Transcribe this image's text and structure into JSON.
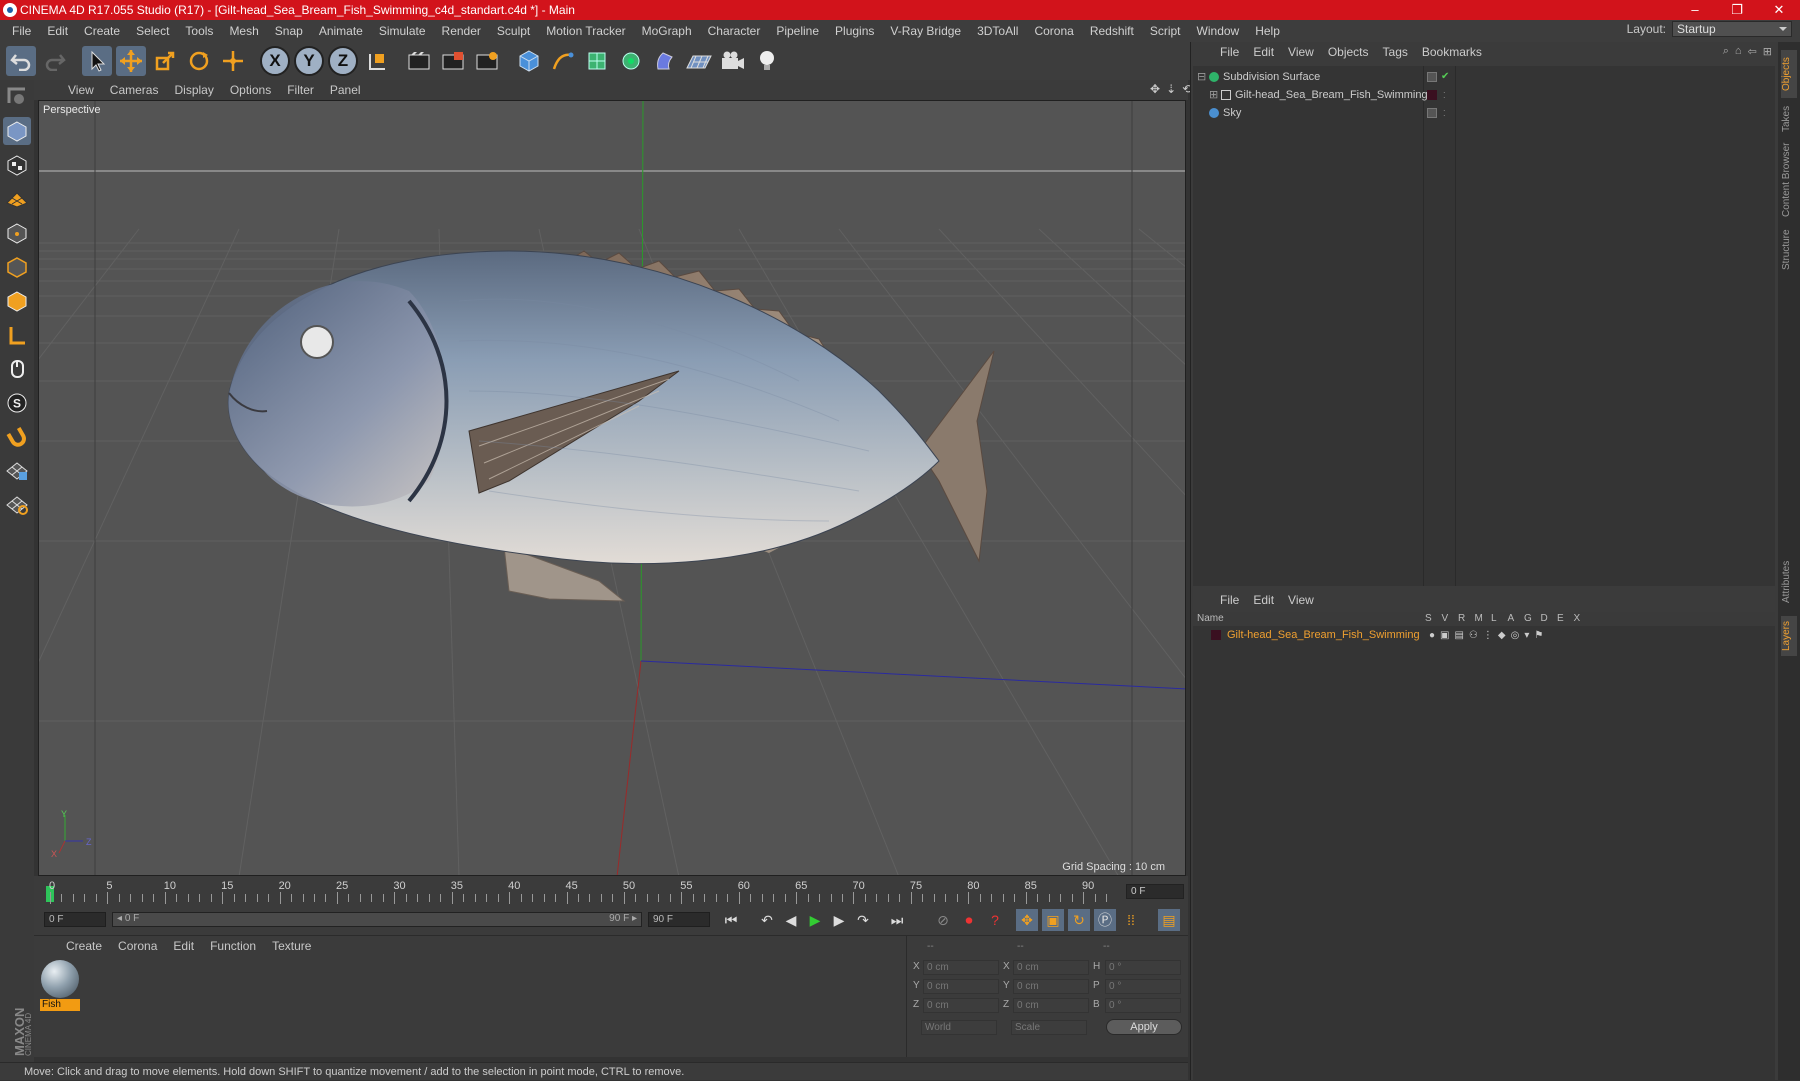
{
  "window": {
    "title": "CINEMA 4D R17.055 Studio (R17) - [Gilt-head_Sea_Bream_Fish_Swimming_c4d_standart.c4d *] - Main",
    "controls": [
      "–",
      "❐",
      "✕"
    ]
  },
  "menu": [
    "File",
    "Edit",
    "Create",
    "Select",
    "Tools",
    "Mesh",
    "Snap",
    "Animate",
    "Simulate",
    "Render",
    "Sculpt",
    "Motion Tracker",
    "MoGraph",
    "Character",
    "Pipeline",
    "Plugins",
    "V-Ray Bridge",
    "3DToAll",
    "Corona",
    "Redshift",
    "Script",
    "Window",
    "Help"
  ],
  "layout": {
    "label": "Layout:",
    "value": "Startup"
  },
  "toolbar": {
    "icons": [
      "undo-icon",
      "redo-icon",
      "select-arrow-icon",
      "move-icon",
      "scale-icon",
      "rotate-icon",
      "transform-icon",
      "x-axis-icon",
      "y-axis-icon",
      "z-axis-icon",
      "world-coord-icon",
      "render-view-icon",
      "render-region-icon",
      "render-settings-icon",
      "cube-icon",
      "pen-icon",
      "subdivision-icon",
      "cloner-icon",
      "deformer-icon",
      "floor-icon",
      "camera-icon",
      "light-icon"
    ],
    "axis_labels": [
      "X",
      "Y",
      "Z"
    ]
  },
  "left_tools": [
    "model-mode-icon",
    "texture-mode-icon",
    "workplane-icon",
    "points-mode-icon",
    "edges-mode-icon",
    "polygons-mode-icon",
    "axis-mode-icon",
    "tweak-icon",
    "solo-icon",
    "magnet-icon",
    "snap-grid-icon",
    "snap-lock-icon"
  ],
  "viewport": {
    "menu": [
      "View",
      "Cameras",
      "Display",
      "Options",
      "Filter",
      "Panel"
    ],
    "label": "Perspective",
    "grid_spacing": "Grid Spacing : 10 cm",
    "axis_labels": [
      "Y",
      "Z",
      "X"
    ]
  },
  "timeline": {
    "ticks": [
      "0",
      "5",
      "10",
      "15",
      "20",
      "25",
      "30",
      "35",
      "40",
      "45",
      "50",
      "55",
      "60",
      "65",
      "70",
      "75",
      "80",
      "85",
      "90"
    ],
    "current_frame": "0 F",
    "start_field": "0 F",
    "range_start": "0 F",
    "range_end": "90 F",
    "end_field": "90 F"
  },
  "materials": {
    "menu": [
      "Create",
      "Corona",
      "Edit",
      "Function",
      "Texture"
    ],
    "items": [
      {
        "name": "Fish"
      }
    ]
  },
  "coords": {
    "headers": [
      "--",
      "--",
      "--"
    ],
    "rows": [
      {
        "a": "X",
        "av": "0 cm",
        "b": "X",
        "bv": "0 cm",
        "c": "H",
        "cv": "0 °"
      },
      {
        "a": "Y",
        "av": "0 cm",
        "b": "Y",
        "bv": "0 cm",
        "c": "P",
        "cv": "0 °"
      },
      {
        "a": "Z",
        "av": "0 cm",
        "b": "Z",
        "bv": "0 cm",
        "c": "B",
        "cv": "0 °"
      }
    ],
    "space": "World",
    "mode": "Scale",
    "apply": "Apply"
  },
  "status": "Move: Click and drag to move elements. Hold down SHIFT to quantize movement / add to the selection in point mode, CTRL to remove.",
  "objects_panel": {
    "menu": [
      "File",
      "Edit",
      "View",
      "Objects",
      "Tags",
      "Bookmarks"
    ],
    "items": [
      {
        "name": "Subdivision Surface",
        "color": "#2fb36a"
      },
      {
        "name": "Gilt-head_Sea_Bream_Fish_Swimming",
        "color": "#cccccc"
      },
      {
        "name": "Sky",
        "color": "#4a8fd0"
      }
    ]
  },
  "layers_panel": {
    "menu": [
      "File",
      "Edit",
      "View"
    ],
    "columns": [
      "Name",
      "S",
      "V",
      "R",
      "M",
      "L",
      "A",
      "G",
      "D",
      "E",
      "X"
    ],
    "items": [
      {
        "name": "Gilt-head_Sea_Bream_Fish_Swimming",
        "color": "#f0a030"
      }
    ]
  },
  "side_tabs": [
    "Objects",
    "Takes",
    "Content Browser",
    "Structure",
    "Attributes",
    "Layers"
  ],
  "colors": {
    "titlebar": "#d2131b",
    "accent": "#f29b12",
    "active_tool": "#5a6d84"
  }
}
